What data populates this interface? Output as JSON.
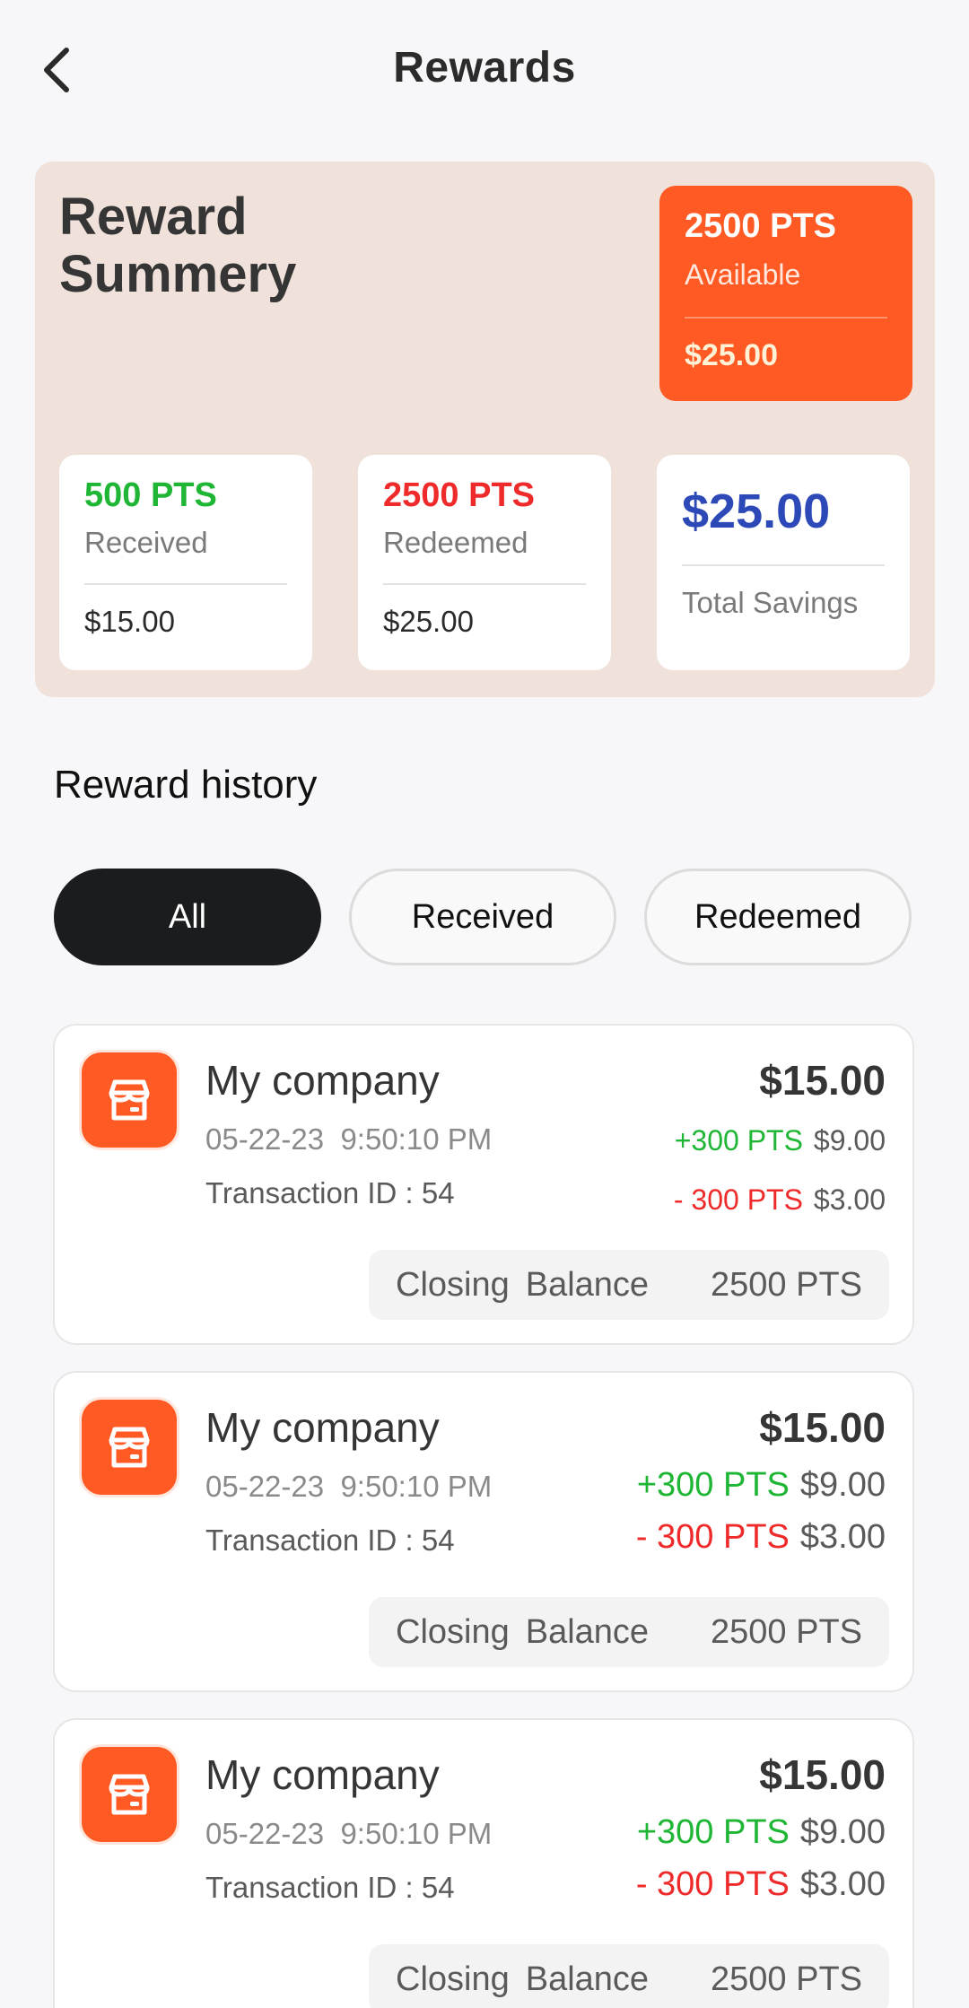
{
  "header": {
    "title": "Rewards",
    "back_icon": "chevron-left-icon"
  },
  "summary": {
    "title": "Reward Summery",
    "available": {
      "points": "2500 PTS",
      "label": "Available",
      "amount": "$25.00"
    },
    "received": {
      "points": "500 PTS",
      "label": "Received",
      "amount": "$15.00"
    },
    "redeemed": {
      "points": "2500 PTS",
      "label": "Redeemed",
      "amount": "$25.00"
    },
    "savings": {
      "amount": "$25.00",
      "label": "Total Savings"
    }
  },
  "history": {
    "title": "Reward history",
    "filters": [
      "All",
      "Received",
      "Redeemed"
    ],
    "selected_filter": "All",
    "transactions": [
      {
        "company": "My company",
        "date": "05-22-23",
        "time": "9:50:10 PM",
        "transaction_label": "Transaction ID : 54",
        "total": "$15.00",
        "plus_pts": "+300 PTS",
        "plus_amount": "$9.00",
        "minus_pts": "- 300 PTS",
        "minus_amount": "$3.00",
        "closing_word1": "Closing",
        "closing_word2": "Balance",
        "closing_value": "2500 PTS"
      },
      {
        "company": "My company",
        "date": "05-22-23",
        "time": "9:50:10 PM",
        "transaction_label": "Transaction ID : 54",
        "total": "$15.00",
        "plus_pts": "+300 PTS",
        "plus_amount": "$9.00",
        "minus_pts": "- 300 PTS",
        "minus_amount": "$3.00",
        "closing_word1": "Closing",
        "closing_word2": "Balance",
        "closing_value": "2500 PTS"
      },
      {
        "company": "My company",
        "date": "05-22-23",
        "time": "9:50:10 PM",
        "transaction_label": "Transaction ID : 54",
        "total": "$15.00",
        "plus_pts": "+300 PTS",
        "plus_amount": "$9.00",
        "minus_pts": "- 300 PTS",
        "minus_amount": "$3.00",
        "closing_word1": "Closing",
        "closing_word2": "Balance",
        "closing_value": "2500 PTS"
      }
    ]
  },
  "colors": {
    "accent": "#ff5a23",
    "positive": "#1fb636",
    "negative": "#ee2a2a",
    "savings": "#2d49b8",
    "summary_bg": "#f0e1db",
    "selected_filter_bg": "#1b1c1e"
  },
  "icons": {
    "store": "store-icon"
  }
}
